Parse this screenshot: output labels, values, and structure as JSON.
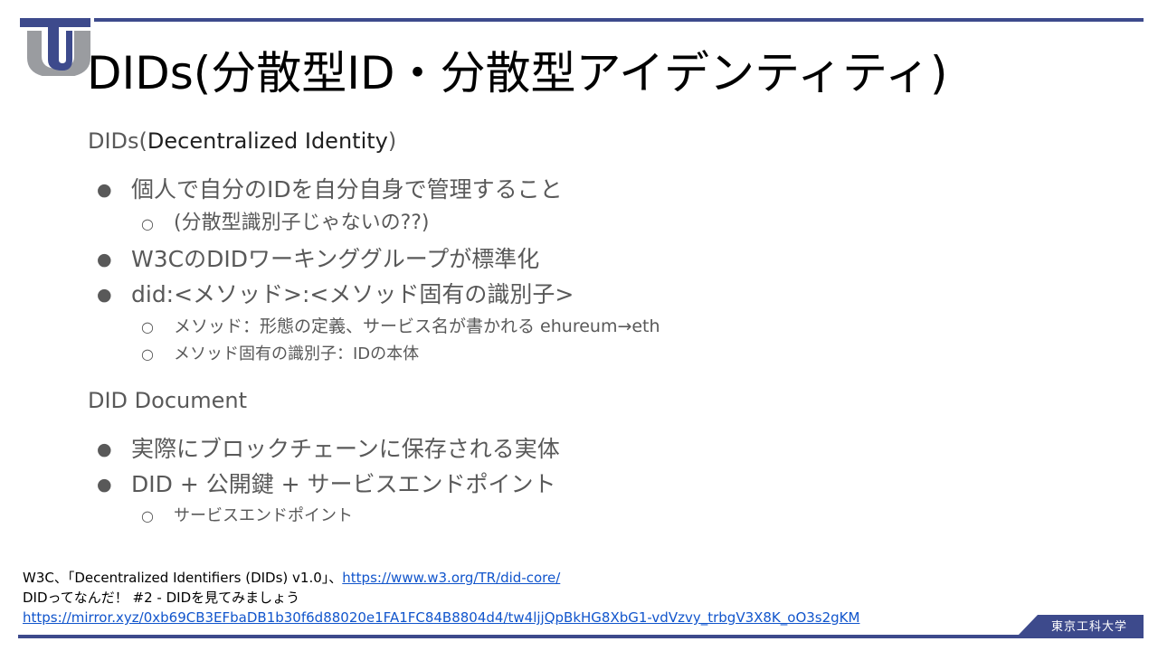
{
  "slide": {
    "title": "DIDs(分散型ID・分散型アイデンティティ)",
    "sections": [
      {
        "heading_prefix": "DIDs(",
        "heading_main": "Decentralized Identity",
        "heading_suffix": ")",
        "bullets": [
          {
            "text": "個人で自分のIDを自分自身で管理すること",
            "sub": [
              "(分散型識別子じゃないの??)"
            ]
          },
          {
            "text": "W3CのDIDワーキンググループが標準化",
            "sub": []
          },
          {
            "text": "did:<メソッド>:<メソッド固有の識別子>",
            "sub": [
              "メソッド：形態の定義、サービス名が書かれる ehureum→eth",
              "メソッド固有の識別子：IDの本体"
            ]
          }
        ]
      },
      {
        "heading": "DID Document",
        "bullets": [
          {
            "text": "実際にブロックチェーンに保存される実体",
            "sub": []
          },
          {
            "text": "DID + 公開鍵 + サービスエンドポイント",
            "sub": [
              "サービスエンドポイント"
            ]
          }
        ]
      }
    ],
    "bullet_glyph": "●",
    "sub_bullet_glyph": "○",
    "references": [
      {
        "prefix": "W3C、「Decentralized Identifiers (DIDs) v1.0」、",
        "link": "https://www.w3.org/TR/did-core/"
      },
      {
        "prefix": "DIDってなんだ！ #2 - DIDを見てみましょう",
        "link": "https://mirror.xyz/0xb69CB3EFbaDB1b30f6d88020e1FA1FC84B8804d4/tw4ljjQpBkHG8XbG1-vdVzvy_trbgV3X8K_oO3s2gKM"
      }
    ],
    "university_name": "東京工科大学",
    "logo_text": "TU",
    "colors": {
      "accent": "#3d4a8c",
      "logo_gray": "#9a9ca0",
      "text_gray": "#595959",
      "link": "#1155cc"
    }
  }
}
